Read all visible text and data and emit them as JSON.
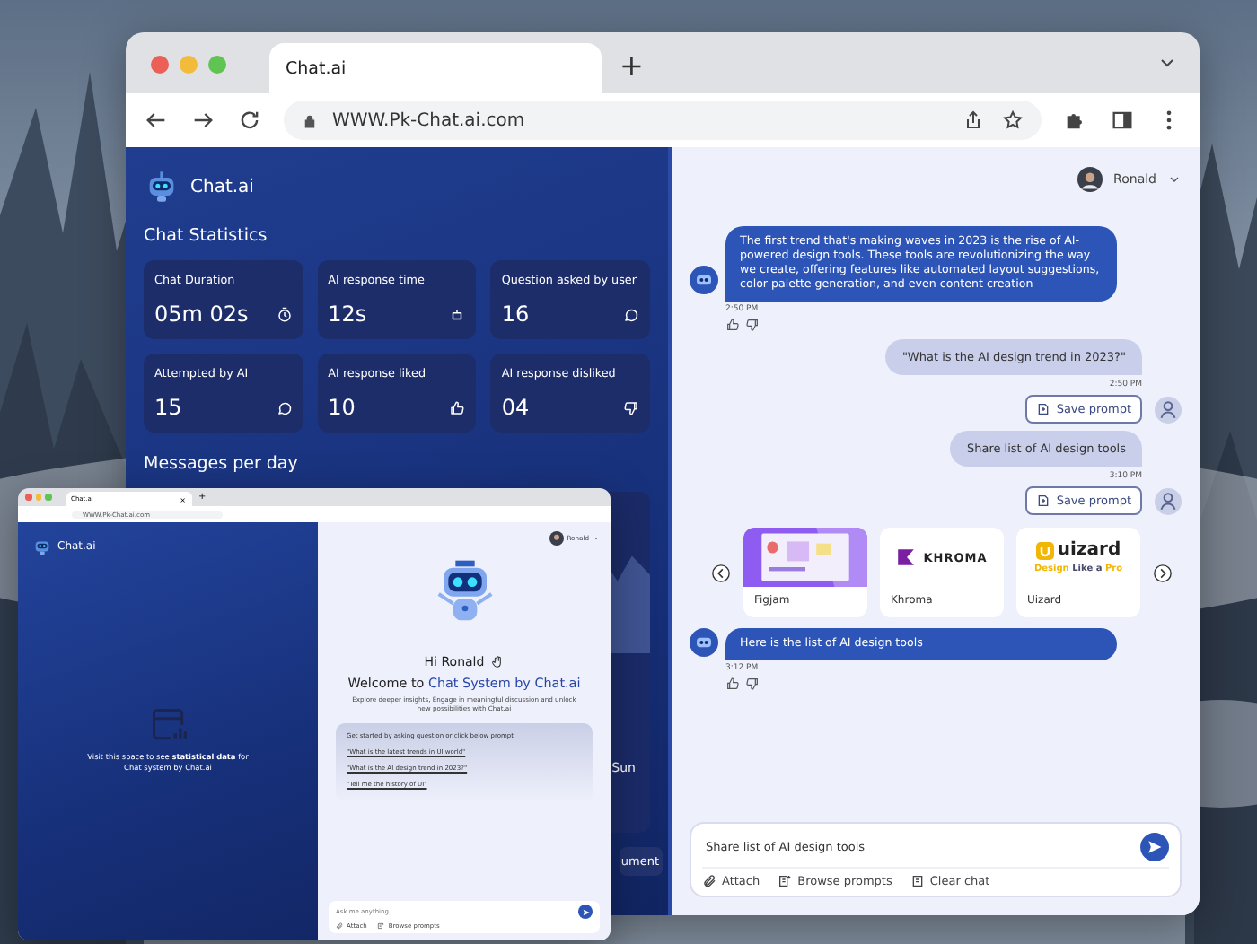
{
  "main_window": {
    "tab": {
      "title": "Chat.ai"
    },
    "new_tab": "+",
    "address": "WWW.Pk-Chat.ai.com",
    "sidebar": {
      "brand": "Chat.ai",
      "stats_title": "Chat Statistics",
      "stats": [
        {
          "label": "Chat Duration",
          "value": "05m 02s"
        },
        {
          "label": "AI response time",
          "value": "12s"
        },
        {
          "label": "Question asked by user",
          "value": "16"
        },
        {
          "label": "Attempted by AI",
          "value": "15"
        },
        {
          "label": "AI response liked",
          "value": "10"
        },
        {
          "label": "AI response disliked",
          "value": "04"
        }
      ],
      "messages_title": "Messages per day",
      "chart_day": "Sun",
      "chart_button": "ument"
    },
    "chat": {
      "user": "Ronald",
      "messages": [
        {
          "kind": "bot",
          "text": "The first trend that's making waves in 2023 is the rise of AI-powered design tools. These tools are revolutionizing the way we create, offering features like automated layout suggestions, color palette generation, and even content creation",
          "time": "2:50 PM"
        },
        {
          "kind": "user",
          "text": "\"What is the AI design trend in 2023?\"",
          "time": "2:50 PM",
          "button": "Save prompt"
        },
        {
          "kind": "user",
          "text": "Share list of AI design tools",
          "time": "3:10 PM",
          "button": "Save prompt"
        },
        {
          "kind": "carousel",
          "cards": [
            {
              "kind": "figjam",
              "name": "Figjam"
            },
            {
              "kind": "khroma",
              "name": "Khroma",
              "logo_text": "KHROMA"
            },
            {
              "kind": "uizard",
              "name": "Uizard",
              "logo_text": "uizard",
              "tagline": [
                {
                  "text": "Design",
                  "color": "#f2b705"
                },
                {
                  "text": "Like a",
                  "color": "#4a4a6a"
                },
                {
                  "text": "Pro",
                  "color": "#f2b705"
                }
              ]
            }
          ]
        },
        {
          "kind": "bot",
          "text": "Here is the list of AI design tools",
          "time": "3:12 PM"
        }
      ],
      "input": {
        "value": "Share list of AI design tools"
      },
      "actions": [
        {
          "label": "Attach"
        },
        {
          "label": "Browse prompts"
        },
        {
          "label": "Clear chat"
        }
      ]
    }
  },
  "small_window": {
    "tab": {
      "title": "Chat.ai",
      "close": "×"
    },
    "new_tab": "+",
    "address": "WWW.Pk-Chat.ai.com",
    "sidebar": {
      "brand": "Chat.ai",
      "empty_text": "Visit this space to see **statistical data** for Chat system by Chat.ai"
    },
    "chat": {
      "user": "Ronald",
      "greeting": "Hi Ronald",
      "title_lead": "Welcome to",
      "title_highlight": "Chat System by Chat.ai",
      "description": "Explore deeper insights, Engage in meaningful discussion and unlock new possibilities with Chat.ai",
      "prompt_intro": "Get started by asking question or click below prompt",
      "prompts": [
        "\"What is the latest trends in UI world\"",
        "\"What is the AI design trend in 2023?\"",
        "\"Tell me the history of UI\""
      ],
      "input": {
        "placeholder": "Ask me anything..."
      },
      "actions": [
        {
          "label": "Attach"
        },
        {
          "label": "Browse prompts"
        }
      ]
    }
  }
}
